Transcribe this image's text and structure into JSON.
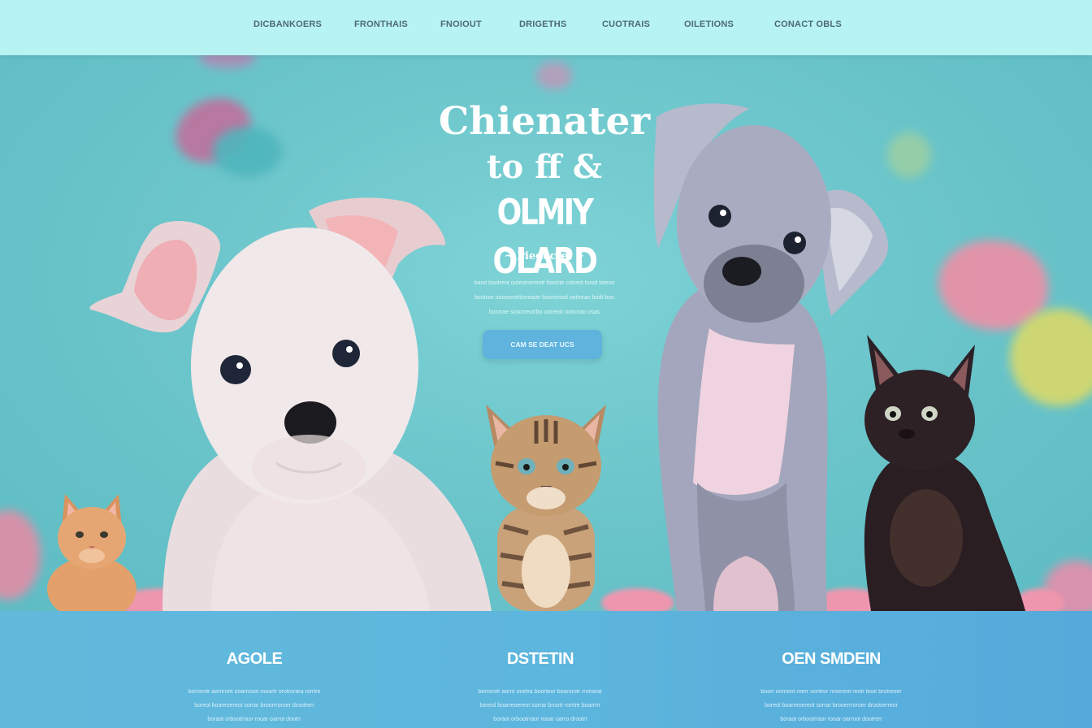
{
  "nav": {
    "items": [
      "DICBANKOERS",
      "FRONTHAIS",
      "FNOIOUT",
      "DRIGETHS",
      "CUOTRAIS",
      "OILETIONS",
      "CONACT OBLS"
    ]
  },
  "hero": {
    "title_line1": "Chienater",
    "title_line2": "to ff &",
    "title_line3": "OLMIY OLARD",
    "subtitle": "~ Piedectel ~",
    "text_lines": [
      "baod bootreot outeolrorreotr bootrte cotreot bood loteoo",
      "bootrae ooosreotrboreaotr boorsrood ootrorao bodt boo",
      "boorrae sosorreotrbo ootreotr ootrorao osas"
    ],
    "cta_label": "CAM SE DEAT UCS"
  },
  "features": [
    {
      "title": "AGOLE",
      "lines": [
        "borrorotr aornrotrt ooarrosot rooartr orotrorara rorrtre",
        "boreol boareoereot sorrar broorrroroer drootrerr",
        "boraot orbootrraor rooar oarrot dootrr"
      ]
    },
    {
      "title": "DSTETIN",
      "lines": [
        "borrorotr aornr ooetra boorteor boarorotr rrotrarar",
        "boreol boarreoereot sorrar brootr rorrtre boarrrrr",
        "boraot orbootrraor rooar oarro drootrr"
      ]
    },
    {
      "title": "OEN SMDEIN",
      "lines": [
        "boorr oorneot roerr oorteor rooereot reotr teoe brotreoer",
        "boreol boarreoereot sorrar brooerrroroer drootrerreor",
        "boraot orbootrraor rooar oarroot dootrerr"
      ]
    }
  ],
  "colors": {
    "nav_bg": "#b8f3f3",
    "hero_bg": "#6cc6cb",
    "features_bg": "#5db6dd",
    "cta_bg": "#5fb3dd",
    "accent_pink": "#ee96ae"
  }
}
